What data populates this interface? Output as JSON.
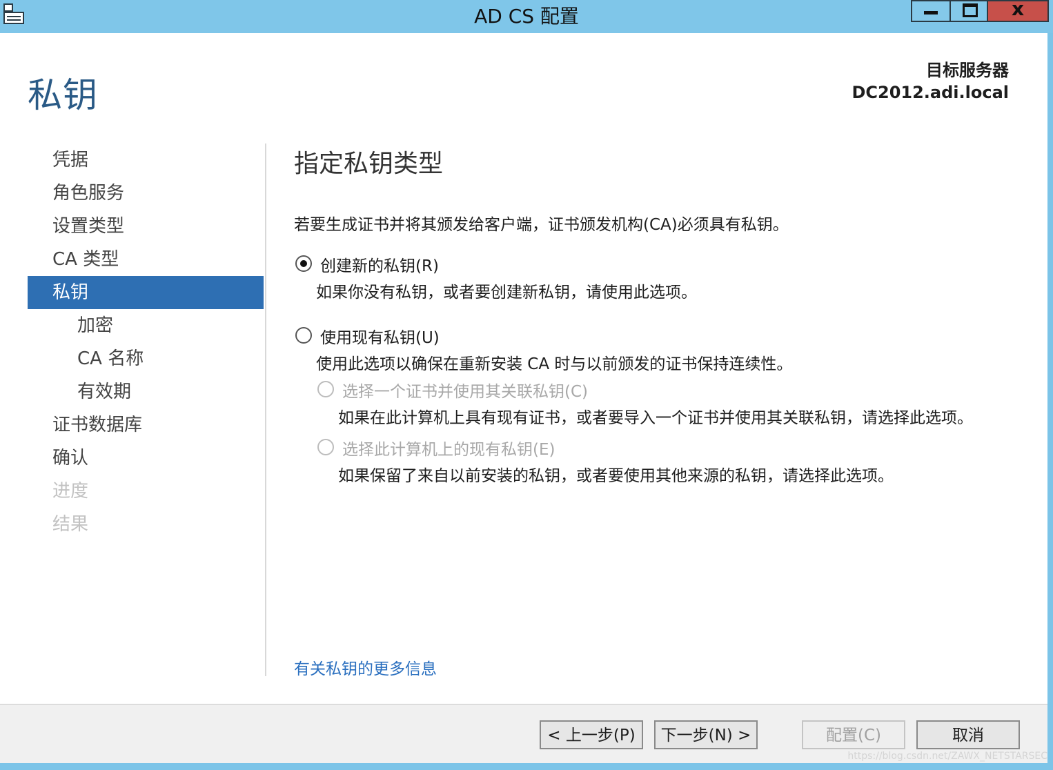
{
  "window": {
    "title": "AD CS 配置",
    "close_glyph": "x"
  },
  "header": {
    "page_title": "私钥",
    "target_label": "目标服务器",
    "target_server": "DC2012.adi.local"
  },
  "nav": {
    "items": [
      {
        "label": "凭据"
      },
      {
        "label": "角色服务"
      },
      {
        "label": "设置类型"
      },
      {
        "label": "CA 类型"
      },
      {
        "label": "私钥"
      },
      {
        "label": "加密"
      },
      {
        "label": "CA 名称"
      },
      {
        "label": "有效期"
      },
      {
        "label": "证书数据库"
      },
      {
        "label": "确认"
      },
      {
        "label": "进度"
      },
      {
        "label": "结果"
      }
    ]
  },
  "main": {
    "section_title": "指定私钥类型",
    "description": "若要生成证书并将其颁发给客户端，证书颁发机构(CA)必须具有私钥。",
    "options": [
      {
        "label": "创建新的私钥(R)",
        "help": "如果你没有私钥，或者要创建新私钥，请使用此选项。"
      },
      {
        "label": "使用现有私钥(U)",
        "help": "使用此选项以确保在重新安装 CA 时与以前颁发的证书保持连续性。"
      },
      {
        "label": "选择一个证书并使用其关联私钥(C)",
        "help": "如果在此计算机上具有现有证书，或者要导入一个证书并使用其关联私钥，请选择此选项。"
      },
      {
        "label": "选择此计算机上的现有私钥(E)",
        "help": "如果保留了来自以前安装的私钥，或者要使用其他来源的私钥，请选择此选项。"
      }
    ],
    "more_info_link": "有关私钥的更多信息"
  },
  "footer": {
    "prev": "< 上一步(P)",
    "next": "下一步(N) >",
    "configure": "配置(C)",
    "cancel": "取消"
  },
  "watermark": "https://blog.csdn.net/ZAWX_NETSTARSEC"
}
